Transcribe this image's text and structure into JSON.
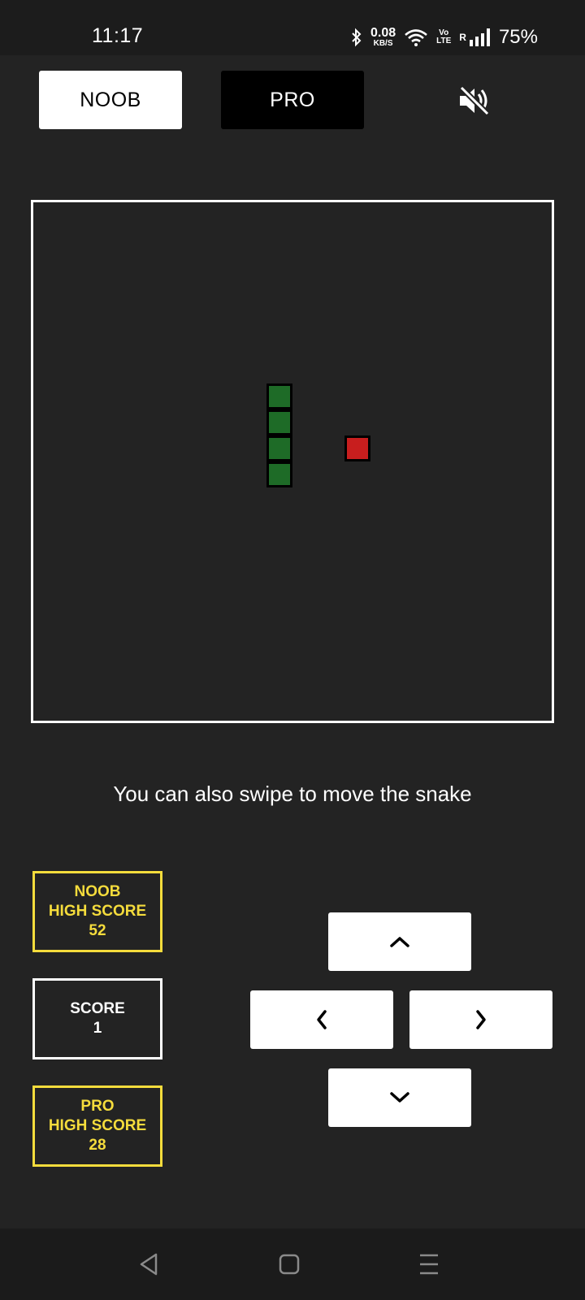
{
  "status_bar": {
    "time": "11:17",
    "net_speed_value": "0.08",
    "net_speed_unit": "KB/S",
    "volte_top": "Vo",
    "volte_bottom": "LTE",
    "roaming": "R",
    "battery": "75%",
    "icons": [
      "bluetooth-icon",
      "wifi-icon",
      "signal-icon"
    ]
  },
  "modes": {
    "noob_label": "NOOB",
    "pro_label": "PRO",
    "selected": "NOOB"
  },
  "sound": {
    "icon": "speaker-muted-icon",
    "muted": true
  },
  "game": {
    "grid_size": 20,
    "snake_color": "#1e6b27",
    "food_color": "#c81e1e",
    "snake_cells": [
      {
        "col": 9,
        "row": 7
      },
      {
        "col": 9,
        "row": 8
      },
      {
        "col": 9,
        "row": 9
      },
      {
        "col": 9,
        "row": 10
      }
    ],
    "food_cell": {
      "col": 12,
      "row": 9
    }
  },
  "hint": "You can also swipe to move the snake",
  "scores": {
    "noob_high_label_1": "NOOB",
    "noob_high_label_2": "HIGH SCORE",
    "noob_high_value": "52",
    "score_label": "SCORE",
    "score_value": "1",
    "pro_high_label_1": "PRO",
    "pro_high_label_2": "HIGH SCORE",
    "pro_high_value": "28",
    "highlight_color": "#f5dc3c"
  },
  "controls": {
    "up_icon": "chevron-up-icon",
    "left_icon": "chevron-left-icon",
    "right_icon": "chevron-right-icon",
    "down_icon": "chevron-down-icon"
  },
  "nav": {
    "icons": [
      "back-triangle-icon",
      "home-square-icon",
      "recents-lines-icon"
    ]
  }
}
